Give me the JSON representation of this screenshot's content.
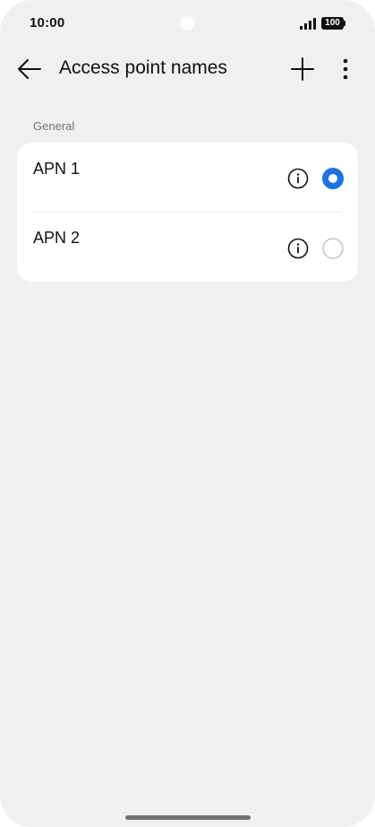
{
  "status_bar": {
    "time": "10:00",
    "battery": "100"
  },
  "app_bar": {
    "title": "Access point names",
    "back_icon": "arrow-left-icon",
    "add_icon": "plus-icon",
    "more_icon": "more-vertical-icon"
  },
  "section": {
    "label": "General",
    "items": [
      {
        "label": "APN 1",
        "selected": true
      },
      {
        "label": "APN 2",
        "selected": false
      }
    ]
  },
  "colors": {
    "background": "#eff0f2",
    "card": "#ffffff",
    "accent": "#1a73e8",
    "text": "#111111",
    "secondary_text": "#707276"
  }
}
